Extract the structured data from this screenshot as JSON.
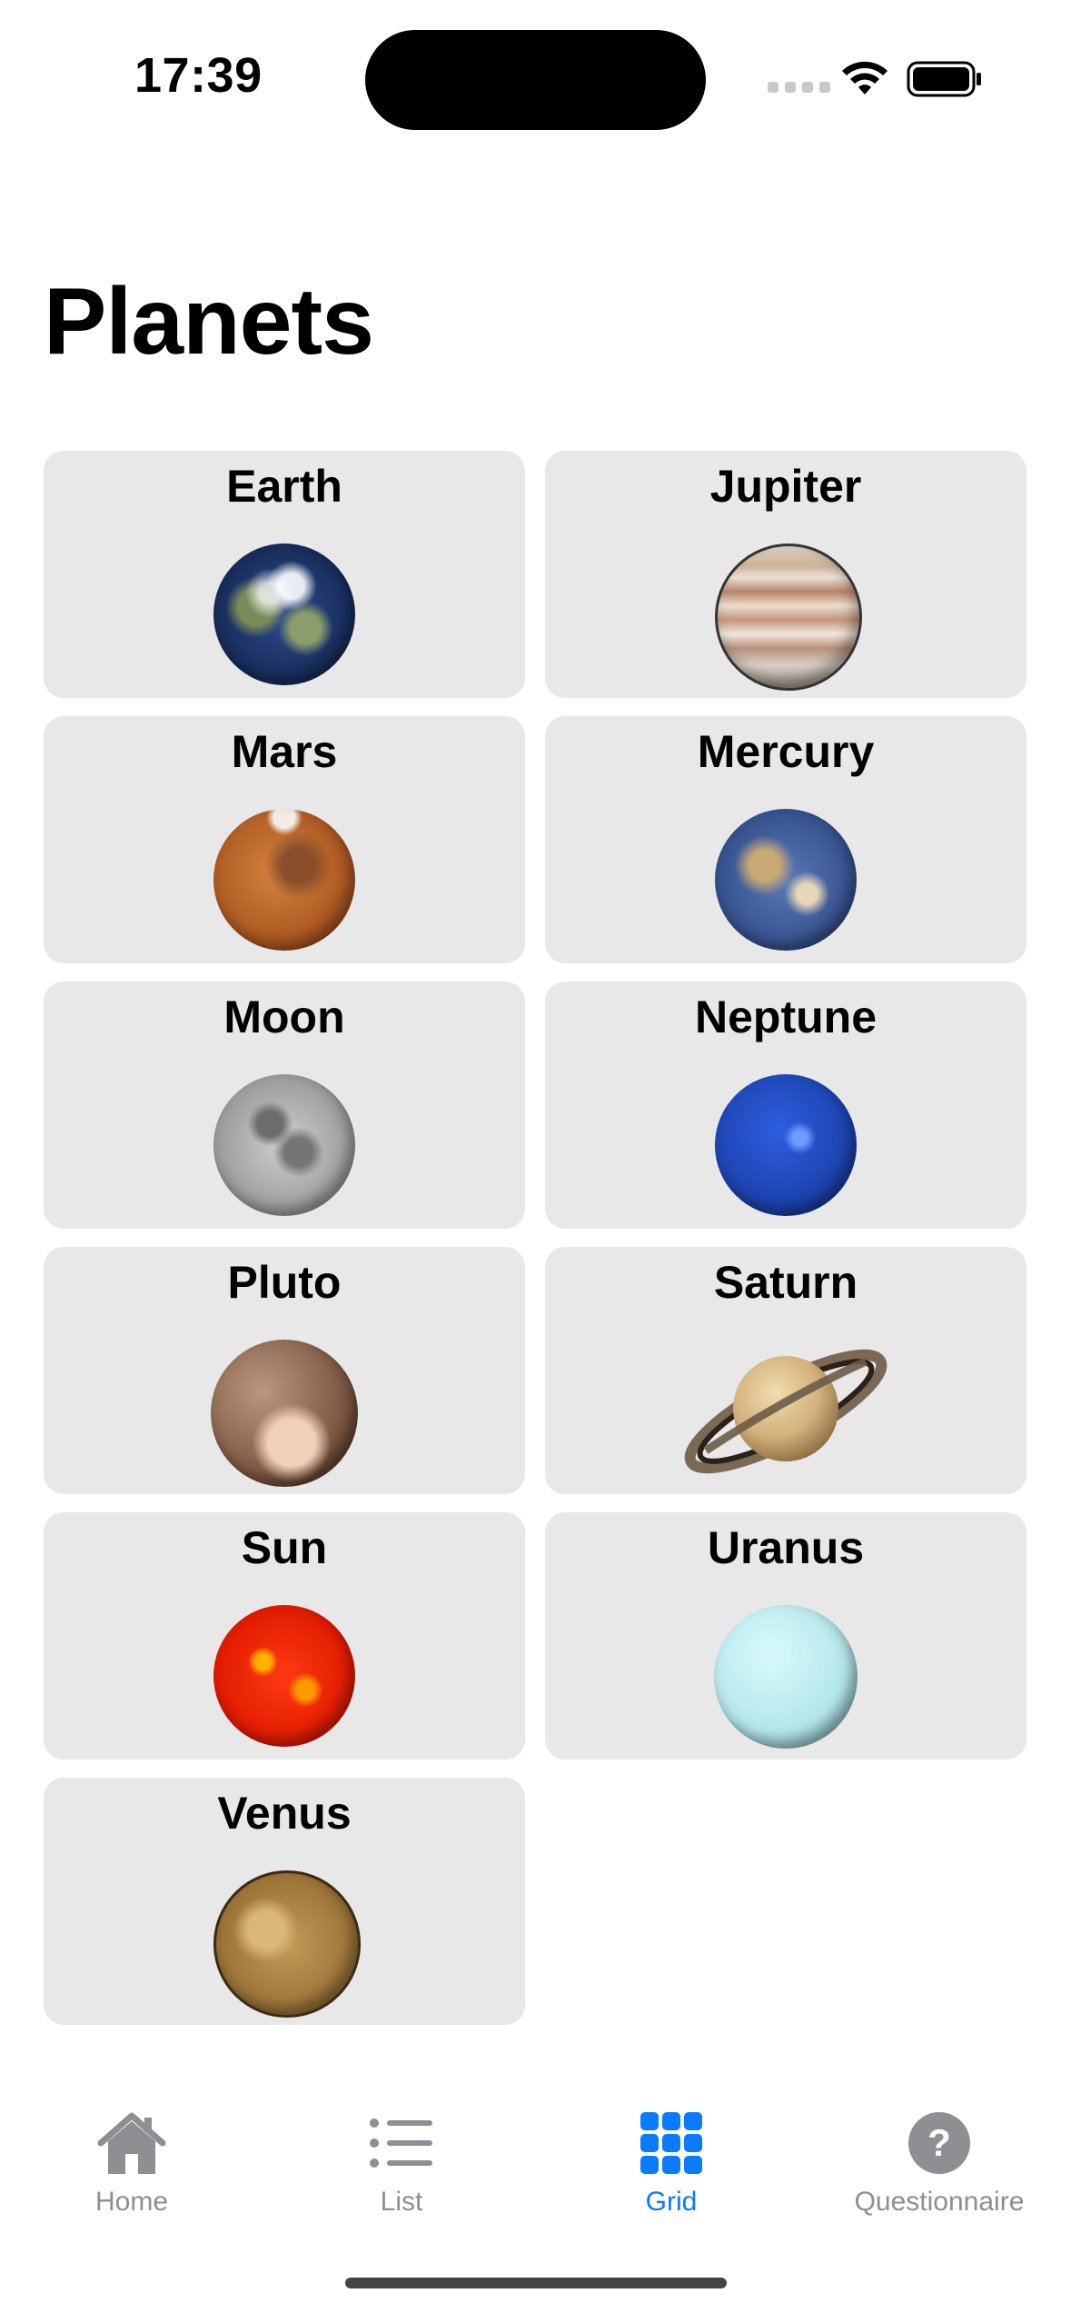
{
  "status_bar": {
    "time": "17:39"
  },
  "page": {
    "title": "Planets"
  },
  "planets": [
    {
      "name": "Earth"
    },
    {
      "name": "Jupiter"
    },
    {
      "name": "Mars"
    },
    {
      "name": "Mercury"
    },
    {
      "name": "Moon"
    },
    {
      "name": "Neptune"
    },
    {
      "name": "Pluto"
    },
    {
      "name": "Saturn"
    },
    {
      "name": "Sun"
    },
    {
      "name": "Uranus"
    },
    {
      "name": "Venus"
    }
  ],
  "tab_bar": {
    "tabs": [
      {
        "label": "Home",
        "icon": "house-icon",
        "selected": false
      },
      {
        "label": "List",
        "icon": "list-icon",
        "selected": false
      },
      {
        "label": "Grid",
        "icon": "grid-icon",
        "selected": true
      },
      {
        "label": "Questionnaire",
        "icon": "question-icon",
        "selected": false
      }
    ],
    "active_color": "#0a7aff",
    "inactive_color": "#8e8e93"
  }
}
